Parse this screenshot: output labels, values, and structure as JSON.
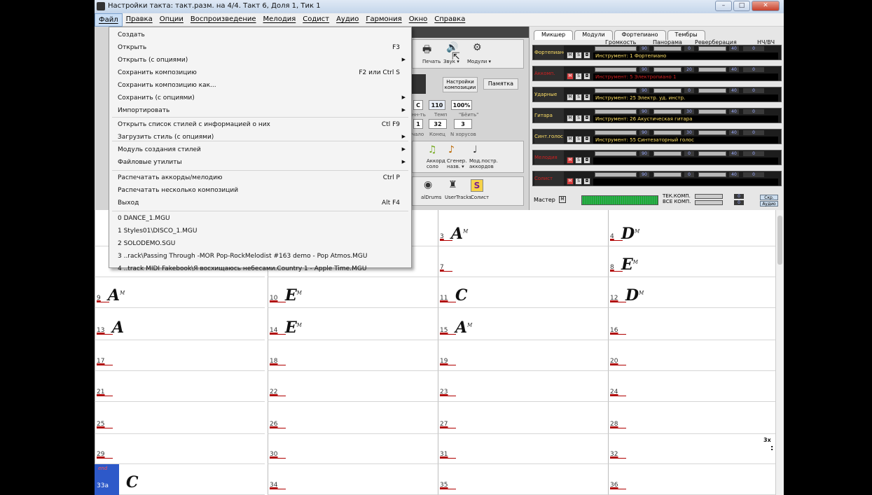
{
  "window": {
    "title": "Настройки такта: такт.разм. на 4/4.  Такт 6, Доля 1, Тик 1"
  },
  "menubar": [
    "Файл",
    "Правка",
    "Опции",
    "Воспроизведение",
    "Мелодия",
    "Содист",
    "Аудио",
    "Гармония",
    "Окно",
    "Справка"
  ],
  "file_menu": {
    "items": [
      {
        "label": "Создать",
        "shortcut": "",
        "submenu": false
      },
      {
        "label": "Открыть",
        "shortcut": "F3",
        "submenu": false
      },
      {
        "label": "Открыть (с опциями)",
        "shortcut": "",
        "submenu": true
      },
      {
        "label": "Сохранить композицию",
        "shortcut": "F2 или Ctrl S",
        "submenu": false
      },
      {
        "label": "Сохранить композицию как...",
        "shortcut": "",
        "submenu": false
      },
      {
        "label": "Сохранить (с опциями)",
        "shortcut": "",
        "submenu": true
      },
      {
        "label": "Импортировать",
        "shortcut": "",
        "submenu": true
      },
      {
        "label": "Открыть список стилей с информацией о них",
        "shortcut": "Ctl F9",
        "submenu": false
      },
      {
        "label": "Загрузить стиль (с опциями)",
        "shortcut": "",
        "submenu": true
      },
      {
        "label": "Модуль создания стилей",
        "shortcut": "",
        "submenu": true
      },
      {
        "label": "Файловые утилиты",
        "shortcut": "",
        "submenu": true
      },
      {
        "label": "Распечатать аккорды/мелодию",
        "shortcut": "Ctrl P",
        "submenu": false
      },
      {
        "label": "Распечатать несколько композиций",
        "shortcut": "",
        "submenu": false
      },
      {
        "label": "Выход",
        "shortcut": "Alt F4",
        "submenu": false
      },
      {
        "label": "0 DANCE_1.MGU",
        "shortcut": "",
        "submenu": false
      },
      {
        "label": "1 Styles01\\DISCO_1.MGU",
        "shortcut": "",
        "submenu": false
      },
      {
        "label": "2 SOLODEMO.SGU",
        "shortcut": "",
        "submenu": false
      },
      {
        "label": "3 ..rack\\Passing Through -MOR Pop-RockMelodist #163 demo - Pop Atmos.MGU",
        "shortcut": "",
        "submenu": false
      },
      {
        "label": "4 ..track MIDI Fakebook\\Я восхищаюсь небесами.Country 1 - Apple Time.MGU",
        "shortcut": "",
        "submenu": false
      }
    ]
  },
  "toolbar": {
    "print": "Печать",
    "sound": "Звук ▾",
    "modules": "Модули ▾",
    "song_settings": "Настройки композиции",
    "memo": "Памятка",
    "key": "C",
    "tempo": "110",
    "percent": "100%",
    "tempo_label": "Темп",
    "beat_label": "\"Бёить\"",
    "parts_label": "нн-ть",
    "start": "1",
    "end": "32",
    "choruses": "3",
    "start_label": "чало",
    "end_label": "Конец",
    "choruses_label": "N хорусов",
    "chord_solo": "Аккорд соло",
    "gen_name": "Сгенер. назв. ▾",
    "mod_chords": "Мод.постр. аккордов",
    "realdrums": "alDrums",
    "usertracks": "UserTracks",
    "soloist": "Солист"
  },
  "mixer": {
    "tabs": [
      "Микшер",
      "Модули",
      "Фортепиано",
      "Тембры"
    ],
    "columns": [
      "Громкость",
      "Панорама",
      "Реверберация",
      "НЧ/ВЧ"
    ],
    "tracks": [
      {
        "name": "Фортепиано",
        "instrument": "Инструмент: 1 Фортепиано",
        "vol": "90",
        "pan": "0",
        "rev": "40",
        "eq": "0",
        "muted": false
      },
      {
        "name": "Аккомп.",
        "instrument": "Инструмент: 5 Электропиано 1",
        "vol": "90",
        "pan": "20",
        "rev": "40",
        "eq": "0",
        "muted": true
      },
      {
        "name": "Ударные",
        "instrument": "Инструмент: 25 Электр. уд. инстр.",
        "vol": "90",
        "pan": "0",
        "rev": "40",
        "eq": "0",
        "muted": false
      },
      {
        "name": "Гитара",
        "instrument": "Инструмент: 26 Акустическая гитара",
        "vol": "90",
        "pan": "30",
        "rev": "40",
        "eq": "0",
        "muted": false
      },
      {
        "name": "Синт.голос",
        "instrument": "Инструмент: 55 Синтезаторный голос",
        "vol": "90",
        "pan": "30",
        "rev": "40",
        "eq": "0",
        "muted": false
      },
      {
        "name": "Мелодия",
        "instrument": "",
        "vol": "90",
        "pan": "0",
        "rev": "40",
        "eq": "0",
        "muted": true
      },
      {
        "name": "Солист",
        "instrument": "",
        "vol": "90",
        "pan": "0",
        "rev": "40",
        "eq": "0",
        "muted": true
      }
    ],
    "master": {
      "label": "Мастер",
      "tek": "ТЕК.КОМП.",
      "all": "ВСЕ КОМП.",
      "skr": "Скр.",
      "audio": "Аудио",
      "vol1": "0",
      "vol2": "0"
    }
  },
  "chord_sheet": {
    "bars": [
      {
        "n": "3",
        "chord": "A",
        "q": "M"
      },
      {
        "n": "4",
        "chord": "D",
        "q": "M"
      },
      {
        "n": "7",
        "chord": "",
        "q": ""
      },
      {
        "n": "8",
        "chord": "E",
        "q": "M"
      },
      {
        "n": "9",
        "chord": "A",
        "q": "M"
      },
      {
        "n": "10",
        "chord": "E",
        "q": "M"
      },
      {
        "n": "11",
        "chord": "C",
        "q": ""
      },
      {
        "n": "12",
        "chord": "D",
        "q": "M"
      },
      {
        "n": "13",
        "chord": "A",
        "q": ""
      },
      {
        "n": "14",
        "chord": "E",
        "q": "M"
      },
      {
        "n": "15",
        "chord": "A",
        "q": "M"
      },
      {
        "n": "16",
        "chord": "",
        "q": ""
      },
      {
        "n": "17",
        "chord": "",
        "q": ""
      },
      {
        "n": "18",
        "chord": "",
        "q": ""
      },
      {
        "n": "19",
        "chord": "",
        "q": ""
      },
      {
        "n": "20",
        "chord": "",
        "q": ""
      },
      {
        "n": "21",
        "chord": "",
        "q": ""
      },
      {
        "n": "22",
        "chord": "",
        "q": ""
      },
      {
        "n": "23",
        "chord": "",
        "q": ""
      },
      {
        "n": "24",
        "chord": "",
        "q": ""
      },
      {
        "n": "25",
        "chord": "",
        "q": ""
      },
      {
        "n": "26",
        "chord": "",
        "q": ""
      },
      {
        "n": "27",
        "chord": "",
        "q": ""
      },
      {
        "n": "28",
        "chord": "",
        "q": ""
      },
      {
        "n": "29",
        "chord": "",
        "q": ""
      },
      {
        "n": "30",
        "chord": "",
        "q": ""
      },
      {
        "n": "31",
        "chord": "",
        "q": ""
      },
      {
        "n": "32",
        "chord": "",
        "q": ""
      },
      {
        "n": "33a",
        "chord": "C",
        "q": ""
      },
      {
        "n": "34",
        "chord": "",
        "q": ""
      },
      {
        "n": "35",
        "chord": "",
        "q": ""
      },
      {
        "n": "36",
        "chord": "",
        "q": ""
      }
    ],
    "end_marker": "end",
    "repeat_marker": "3x"
  },
  "colors": {
    "accent": "#2d59c9",
    "track_text": "#ffe066",
    "bar_number": "#b00000"
  }
}
